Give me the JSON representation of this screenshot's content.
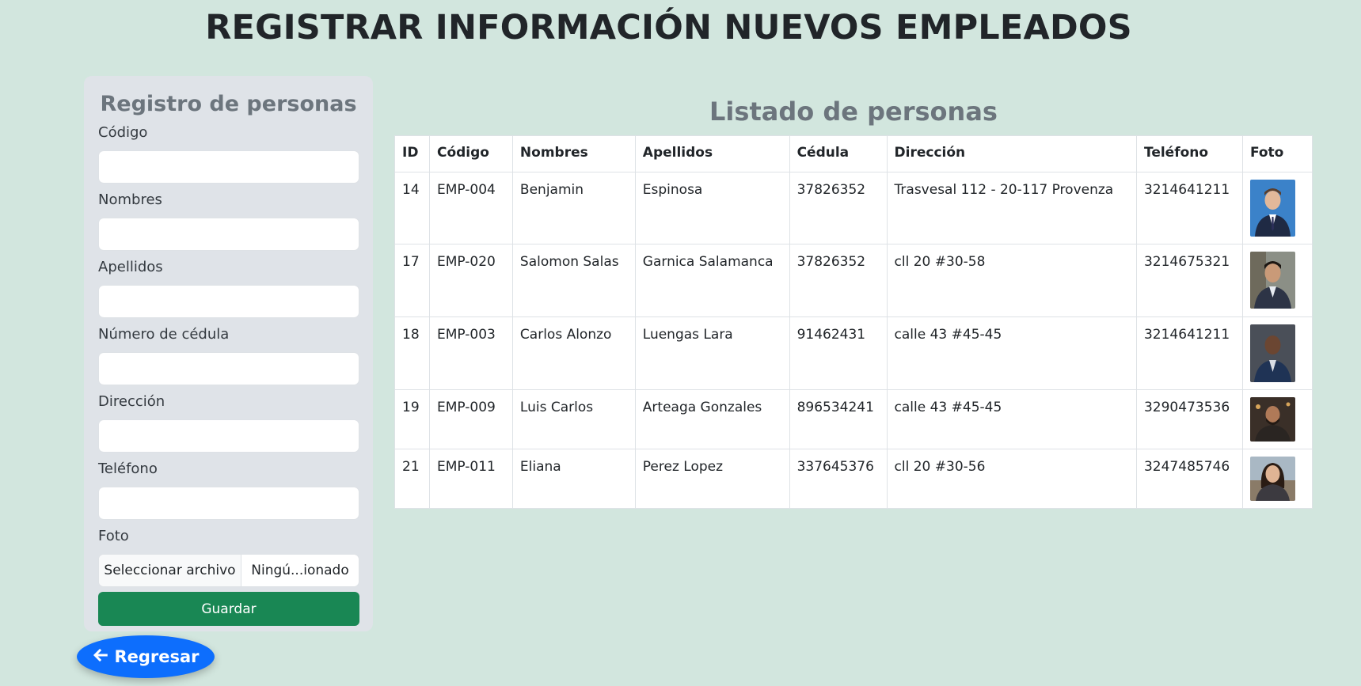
{
  "page": {
    "title": "REGISTRAR INFORMACIÓN NUEVOS EMPLEADOS"
  },
  "form": {
    "title": "Registro de personas",
    "fields": [
      {
        "label": "Código",
        "value": ""
      },
      {
        "label": "Nombres",
        "value": ""
      },
      {
        "label": "Apellidos",
        "value": ""
      },
      {
        "label": "Número de cédula",
        "value": ""
      },
      {
        "label": "Dirección",
        "value": ""
      },
      {
        "label": "Teléfono",
        "value": ""
      }
    ],
    "photo_label": "Foto",
    "file_button": "Seleccionar archivo",
    "file_status": "Ningú...ionado",
    "save_label": "Guardar"
  },
  "back_button": {
    "label": "Regresar",
    "icon": "arrow-left-icon"
  },
  "list": {
    "title": "Listado de personas",
    "columns": [
      "ID",
      "Código",
      "Nombres",
      "Apellidos",
      "Cédula",
      "Dirección",
      "Teléfono",
      "Foto"
    ],
    "rows": [
      {
        "id": "14",
        "codigo": "EMP-004",
        "nombres": "Benjamin",
        "apellidos": "Espinosa",
        "cedula": "37826352",
        "direccion": "Trasvesal 112 - 20-117 Provenza",
        "telefono": "3214641211",
        "photo": "man-suit-blue-background"
      },
      {
        "id": "17",
        "codigo": "EMP-020",
        "nombres": "Salomon Salas",
        "apellidos": "Garnica Salamanca",
        "cedula": "37826352",
        "direccion": "cll 20 #30-58",
        "telefono": "3214675321",
        "photo": "man-suit-smiling"
      },
      {
        "id": "18",
        "codigo": "EMP-003",
        "nombres": "Carlos Alonzo",
        "apellidos": "Luengas Lara",
        "cedula": "91462431",
        "direccion": "calle 43 #45-45",
        "telefono": "3214641211",
        "photo": "man-suit-office"
      },
      {
        "id": "19",
        "codigo": "EMP-009",
        "nombres": "Luis Carlos",
        "apellidos": "Arteaga Gonzales",
        "cedula": "896534241",
        "direccion": "calle 43 #45-45",
        "telefono": "3290473536",
        "photo": "man-bearded-casual"
      },
      {
        "id": "21",
        "codigo": "EMP-011",
        "nombres": "Eliana",
        "apellidos": "Perez Lopez",
        "cedula": "337645376",
        "direccion": "cll 20 #30-56",
        "telefono": "3247485746",
        "photo": "woman-smiling-outdoor"
      }
    ]
  }
}
